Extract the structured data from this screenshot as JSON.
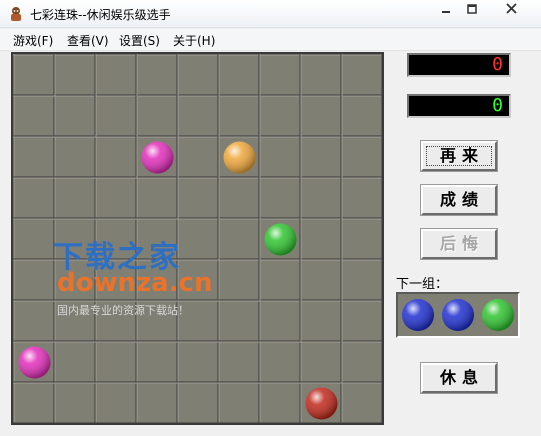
{
  "window": {
    "title": "七彩连珠--休闲娱乐级选手",
    "icon": "app-icon"
  },
  "menu": {
    "items": [
      "游戏(F)",
      "查看(V)",
      "设置(S)",
      "关于(H)"
    ]
  },
  "board": {
    "rows": 9,
    "cols": 9,
    "balls": [
      {
        "row": 2,
        "col": 3,
        "color": "#e22dba"
      },
      {
        "row": 2,
        "col": 5,
        "color": "#f0a83a"
      },
      {
        "row": 4,
        "col": 6,
        "color": "#2fc42f"
      },
      {
        "row": 7,
        "col": 0,
        "color": "#e22dba"
      },
      {
        "row": 8,
        "col": 7,
        "color": "#c0281c"
      }
    ]
  },
  "watermark": {
    "cn": "下载之家",
    "en": "downza.cn",
    "sub": "国内最专业的资源下载站！"
  },
  "scores": {
    "score1": "0",
    "score1_color": "#ff3030",
    "score2": "0",
    "score2_color": "#30ff30"
  },
  "buttons": {
    "restart": "再来",
    "records": "成绩",
    "undo": "后悔",
    "rest": "休息"
  },
  "next": {
    "label": "下一组：",
    "balls": [
      "#1f2fd0",
      "#1f2fd0",
      "#2fc42f"
    ]
  }
}
